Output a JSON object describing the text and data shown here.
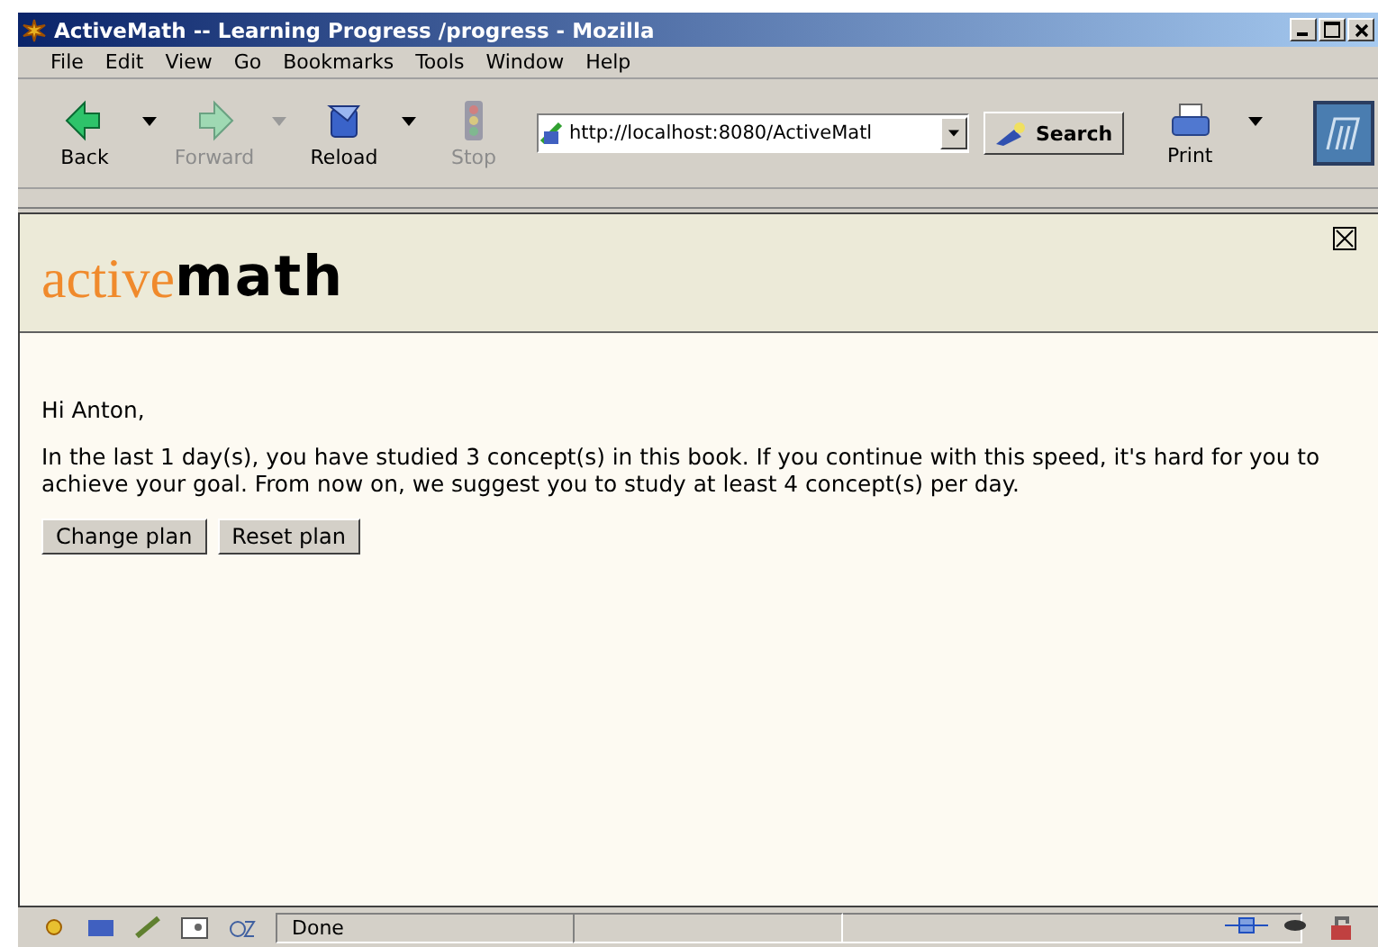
{
  "window": {
    "title": "ActiveMath -- Learning Progress /progress - Mozilla"
  },
  "menu": [
    "File",
    "Edit",
    "View",
    "Go",
    "Bookmarks",
    "Tools",
    "Window",
    "Help"
  ],
  "toolbar": {
    "buttons": [
      {
        "label": "Back",
        "disabled": false,
        "kind": "back"
      },
      {
        "label": "Forward",
        "disabled": true,
        "kind": "forward"
      },
      {
        "label": "Reload",
        "disabled": false,
        "kind": "reload"
      },
      {
        "label": "Stop",
        "disabled": true,
        "kind": "stop"
      }
    ],
    "address": "http://localhost:8080/ActiveMatl",
    "search": "Search",
    "print": "Print"
  },
  "page": {
    "logo": {
      "part_1": "active",
      "part_2": "math"
    },
    "greeting": "Hi Anton,",
    "message": "In the last 1 day(s), you have studied 3 concept(s) in this book. If you continue with this speed, it's hard for you to achieve your goal. From now on, we suggest you to study at least 4 concept(s) per day.",
    "buttons": [
      "Change plan",
      "Reset plan"
    ]
  },
  "status_bar": {
    "text": "Done"
  }
}
